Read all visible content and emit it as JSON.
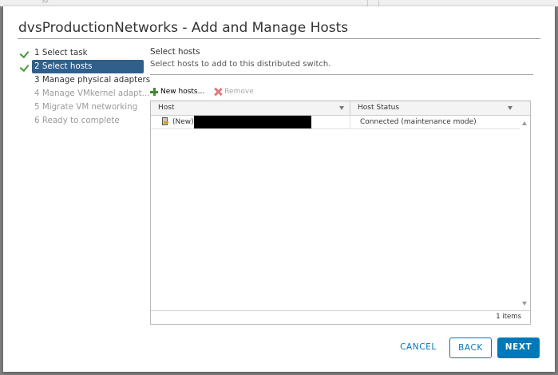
{
  "dialog": {
    "title": "dvsProductionNetworks - Add and Manage Hosts"
  },
  "background": {
    "number": "32"
  },
  "steps": [
    {
      "label": "1 Select task",
      "state": "done"
    },
    {
      "label": "2 Select hosts",
      "state": "active"
    },
    {
      "label": "3 Manage physical adapters",
      "state": "enabled"
    },
    {
      "label": "4 Manage VMkernel adapt...",
      "state": "disabled"
    },
    {
      "label": "5 Migrate VM networking",
      "state": "disabled"
    },
    {
      "label": "6 Ready to complete",
      "state": "disabled"
    }
  ],
  "section": {
    "title": "Select hosts",
    "description": "Select hosts to add to this distributed switch."
  },
  "toolbar": {
    "new_hosts_label": "New hosts...",
    "remove_label": "Remove"
  },
  "grid": {
    "columns": [
      "Host",
      "Host Status"
    ],
    "rows": [
      {
        "prefix": "(New)",
        "host": "",
        "status": "Connected (maintenance mode)"
      }
    ],
    "footer": "1 items"
  },
  "buttons": {
    "cancel": "CANCEL",
    "back": "BACK",
    "next": "NEXT"
  },
  "colors": {
    "accent": "#0079b8",
    "active_step": "#305f8c",
    "check": "#4a9a3a"
  }
}
